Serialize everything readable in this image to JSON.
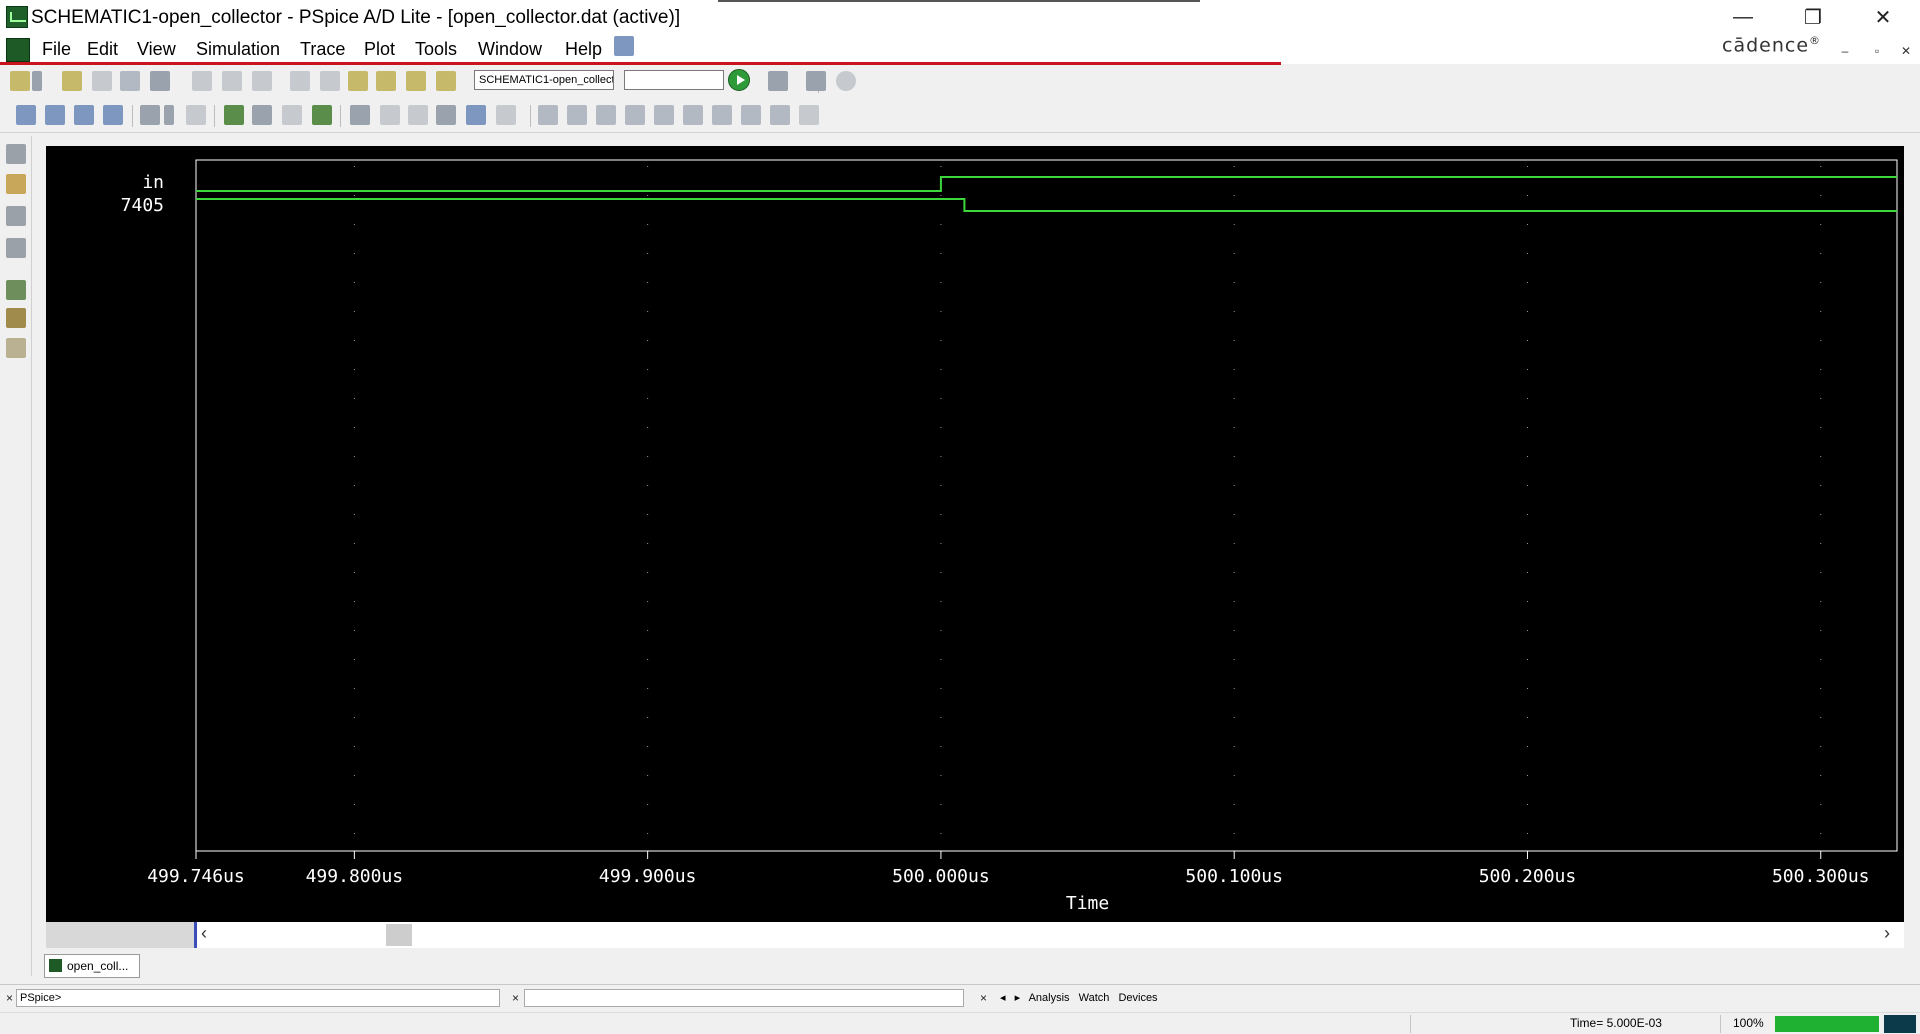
{
  "window": {
    "title": "SCHEMATIC1-open_collector - PSpice A/D Lite - [open_collector.dat (active)]",
    "min_glyph": "—",
    "restore_glyph": "❐",
    "close_glyph": "✕"
  },
  "menu": {
    "items": [
      "File",
      "Edit",
      "View",
      "Simulation",
      "Trace",
      "Plot",
      "Tools",
      "Window",
      "Help"
    ]
  },
  "brand": {
    "name": "cādence",
    "mark": "®"
  },
  "mdi": {
    "min_glyph": "–",
    "restore_glyph": "▫",
    "close_glyph": "✕"
  },
  "toolbar": {
    "profile_value": "SCHEMATIC1-open_collect",
    "sweep_value": ""
  },
  "plot": {
    "background": "#000000",
    "trace_color": "#3dd63d",
    "axis_color": "#ffffff",
    "time_label": "Time",
    "signals": [
      "in",
      "7405"
    ]
  },
  "chart_data": {
    "type": "line",
    "title": "",
    "xlabel": "Time",
    "ylabel": "",
    "x_unit": "us",
    "xlim": [
      499.746,
      500.326
    ],
    "x_ticks": [
      {
        "value": 499.746,
        "label": "499.746us"
      },
      {
        "value": 499.8,
        "label": "499.800us"
      },
      {
        "value": 499.9,
        "label": "499.900us"
      },
      {
        "value": 500.0,
        "label": "500.000us"
      },
      {
        "value": 500.1,
        "label": "500.100us"
      },
      {
        "value": 500.2,
        "label": "500.200us"
      },
      {
        "value": 500.3,
        "label": "500.300us"
      }
    ],
    "grid": true,
    "series": [
      {
        "name": "in",
        "kind": "digital",
        "x": [
          499.746,
          500.0,
          500.0,
          500.326
        ],
        "levels": [
          0,
          0,
          1,
          1
        ]
      },
      {
        "name": "7405",
        "kind": "digital",
        "x": [
          499.746,
          500.008,
          500.008,
          500.326
        ],
        "levels": [
          1,
          1,
          0,
          0
        ]
      }
    ]
  },
  "tabs": {
    "document": "open_coll..."
  },
  "bottom": {
    "prompt": "PSpice>",
    "close_glyph": "×",
    "tabs": [
      "Analysis",
      "Watch",
      "Devices"
    ]
  },
  "status": {
    "time": "Time= 5.000E-03",
    "zoom": "100%",
    "progress": 1.0
  }
}
